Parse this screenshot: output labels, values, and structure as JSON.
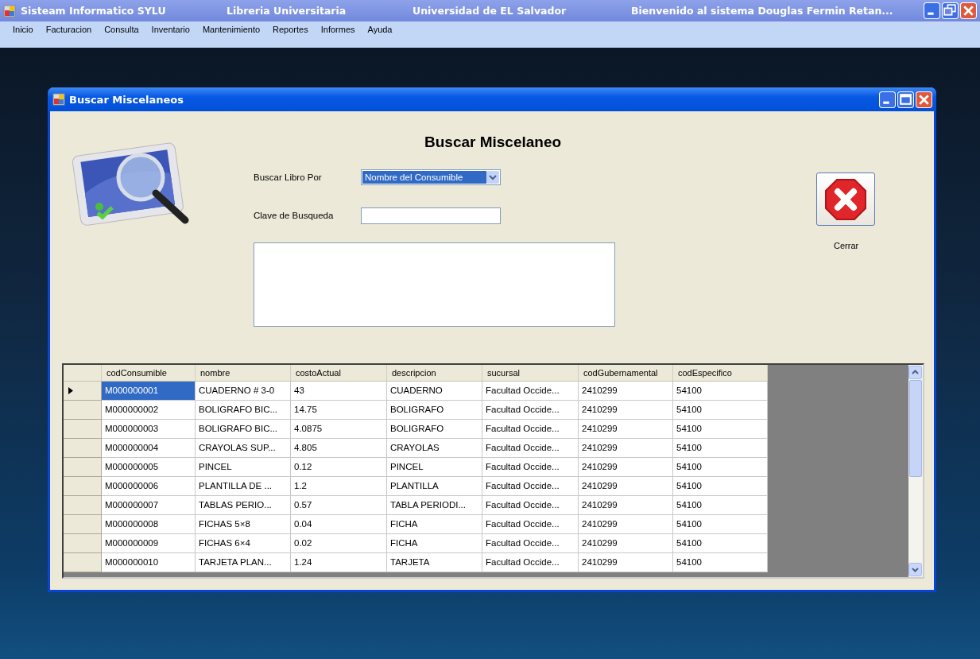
{
  "app": {
    "title_segments": [
      "Sisteam Informatico SYLU",
      "Libreria Universitaria",
      "Universidad de EL Salvador",
      "Bienvenido al sistema Douglas Fermin Retan..."
    ]
  },
  "menu": [
    "Inicio",
    "Facturacion",
    "Consulta",
    "Inventario",
    "Mantenimiento",
    "Reportes",
    "Informes",
    "Ayuda"
  ],
  "dialog": {
    "title": "Buscar Miscelaneos",
    "heading": "Buscar Miscelaneo",
    "search_by": {
      "label": "Buscar Libro Por",
      "value": "Nombre del Consumible"
    },
    "search_key": {
      "label": "Clave de Busqueda"
    },
    "close_button": {
      "label": "Cerrar"
    },
    "table": {
      "columns": [
        "codConsumible",
        "nombre",
        "costoActual",
        "descripcion",
        "sucursal",
        "codGubernamental",
        "codEspecifico"
      ],
      "rows": [
        {
          "selected": true,
          "cells": [
            "M000000001",
            "CUADERNO # 3-0",
            "43",
            "CUADERNO",
            "Facultad Occide...",
            "2410299",
            "54100"
          ]
        },
        {
          "selected": false,
          "cells": [
            "M000000002",
            "BOLIGRAFO BIC...",
            "14.75",
            "BOLIGRAFO",
            "Facultad Occide...",
            "2410299",
            "54100"
          ]
        },
        {
          "selected": false,
          "cells": [
            "M000000003",
            "BOLIGRAFO BIC...",
            "4.0875",
            "BOLIGRAFO",
            "Facultad Occide...",
            "2410299",
            "54100"
          ]
        },
        {
          "selected": false,
          "cells": [
            "M000000004",
            "CRAYOLAS SUP...",
            "4.805",
            "CRAYOLAS",
            "Facultad Occide...",
            "2410299",
            "54100"
          ]
        },
        {
          "selected": false,
          "cells": [
            "M000000005",
            "PINCEL",
            "0.12",
            "PINCEL",
            "Facultad Occide...",
            "2410299",
            "54100"
          ]
        },
        {
          "selected": false,
          "cells": [
            "M000000006",
            "PLANTILLA DE ...",
            "1.2",
            "PLANTILLA",
            "Facultad Occide...",
            "2410299",
            "54100"
          ]
        },
        {
          "selected": false,
          "cells": [
            "M000000007",
            "TABLAS PERIO...",
            "0.57",
            "TABLA PERIODI...",
            "Facultad Occide...",
            "2410299",
            "54100"
          ]
        },
        {
          "selected": false,
          "cells": [
            "M000000008",
            "FICHAS 5×8",
            "0.04",
            "FICHA",
            "Facultad Occide...",
            "2410299",
            "54100"
          ]
        },
        {
          "selected": false,
          "cells": [
            "M000000009",
            "FICHAS 6×4",
            "0.02",
            "FICHA",
            "Facultad Occide...",
            "2410299",
            "54100"
          ]
        },
        {
          "selected": false,
          "cells": [
            "M000000010",
            "TARJETA PLAN...",
            "1.24",
            "TARJETA",
            "Facultad Occide...",
            "2410299",
            "54100"
          ]
        }
      ]
    }
  }
}
